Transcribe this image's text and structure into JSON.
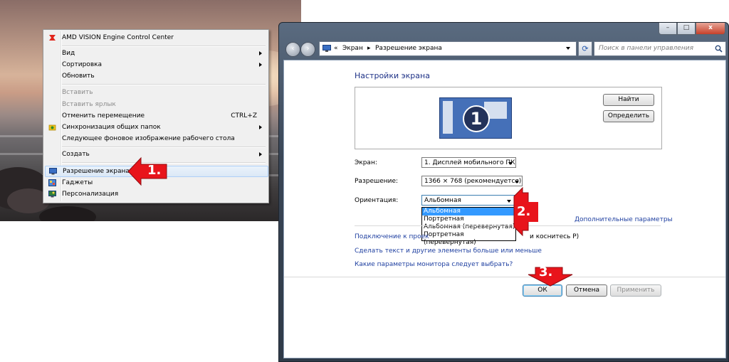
{
  "context_menu": {
    "items": [
      {
        "label": "AMD VISION Engine Control Center",
        "icon": "amd-icon"
      },
      {
        "label": "Вид",
        "submenu": true
      },
      {
        "label": "Сортировка",
        "submenu": true
      },
      {
        "label": "Обновить"
      },
      {
        "label": "Вставить",
        "disabled": true
      },
      {
        "label": "Вставить ярлык",
        "disabled": true
      },
      {
        "label": "Отменить перемещение",
        "shortcut": "CTRL+Z"
      },
      {
        "label": "Синхронизация общих папок",
        "submenu": true,
        "icon": "sync-icon"
      },
      {
        "label": "Следующее фоновое изображение рабочего стола"
      },
      {
        "label": "Создать",
        "submenu": true
      },
      {
        "label": "Разрешение экрана",
        "icon": "display-icon",
        "highlighted": true
      },
      {
        "label": "Гаджеты",
        "icon": "gadgets-icon"
      },
      {
        "label": "Персонализация",
        "icon": "personalization-icon"
      }
    ]
  },
  "window": {
    "controls": {
      "minimize": "–",
      "maximize": "□",
      "close": "x"
    },
    "breadcrumb": {
      "prefix": "«",
      "item1": "Экран",
      "sep": "▸",
      "item2": "Разрешение экрана"
    },
    "search_placeholder": "Поиск в панели управления",
    "heading": "Настройки экрана",
    "monitor_number": "1",
    "find_button": "Найти",
    "identify_button": "Определить",
    "screen_label": "Экран:",
    "screen_value": "1. Дисплей мобильного ПК",
    "resolution_label": "Разрешение:",
    "resolution_value": "1366 × 768 (рекомендуется)",
    "orientation_label": "Ориентация:",
    "orientation_value": "Альбомная",
    "orientation_options": [
      "Альбомная",
      "Портретная",
      "Альбомная (перевернутая)",
      "Портретная (перевернутая)"
    ],
    "advanced_link": "Дополнительные параметры",
    "link_projector": "Подключение к проек",
    "link_projector_tail": "и коснитесь P)",
    "link_text_size": "Сделать текст и другие элементы больше или меньше",
    "link_monitor": "Какие параметры монитора следует выбрать?",
    "ok_button": "ОК",
    "cancel_button": "Отмена",
    "apply_button": "Применить"
  },
  "annotations": {
    "step1": "1.",
    "step2": "2.",
    "step3": "3.",
    "color": "#e8141b"
  }
}
